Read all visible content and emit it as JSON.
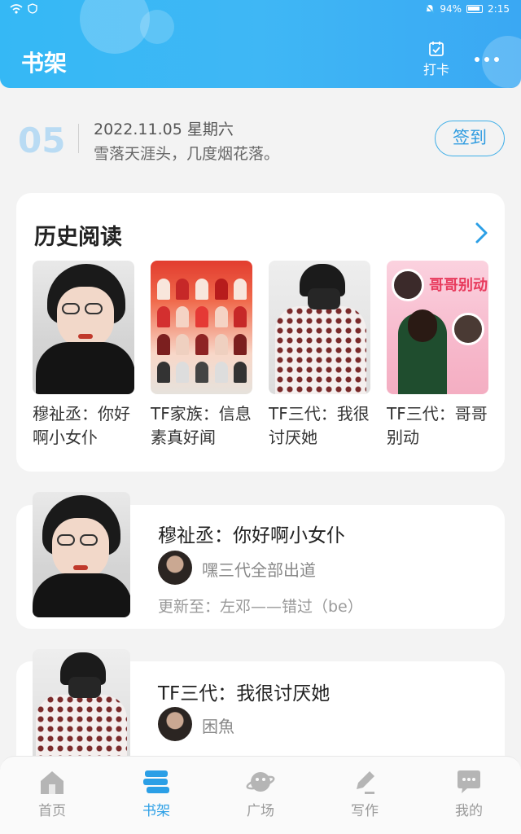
{
  "statusbar": {
    "battery": "94%",
    "time": "2:15"
  },
  "header": {
    "title": "书架",
    "checkin_label": "打卡"
  },
  "date_row": {
    "day": "05",
    "date": "2022.11.05 星期六",
    "quote": "雪落天涯头，几度烟花落。",
    "signin_label": "签到"
  },
  "history": {
    "title": "历史阅读",
    "books": [
      {
        "title": "穆祉丞：你好啊小女仆"
      },
      {
        "title": "TF家族：信息素真好闻"
      },
      {
        "title": "TF三代：我很讨厌她"
      },
      {
        "title": "TF三代：哥哥别动"
      }
    ],
    "cover4_title": "哥哥别动"
  },
  "shelf": [
    {
      "title": "穆祉丞：你好啊小女仆",
      "author": "嘿三代全部出道",
      "update": "更新至：左邓——错过（be）"
    },
    {
      "title": "TF三代：我很讨厌她",
      "author": "困魚"
    }
  ],
  "nav": [
    {
      "label": "首页",
      "icon": "home-icon"
    },
    {
      "label": "书架",
      "icon": "bookshelf-icon",
      "active": true
    },
    {
      "label": "广场",
      "icon": "planet-icon"
    },
    {
      "label": "写作",
      "icon": "pen-icon"
    },
    {
      "label": "我的",
      "icon": "chat-icon"
    }
  ],
  "colors": {
    "accent": "#2b9fe6",
    "header": "#3fb7f5",
    "background": "#f3f3f3"
  }
}
